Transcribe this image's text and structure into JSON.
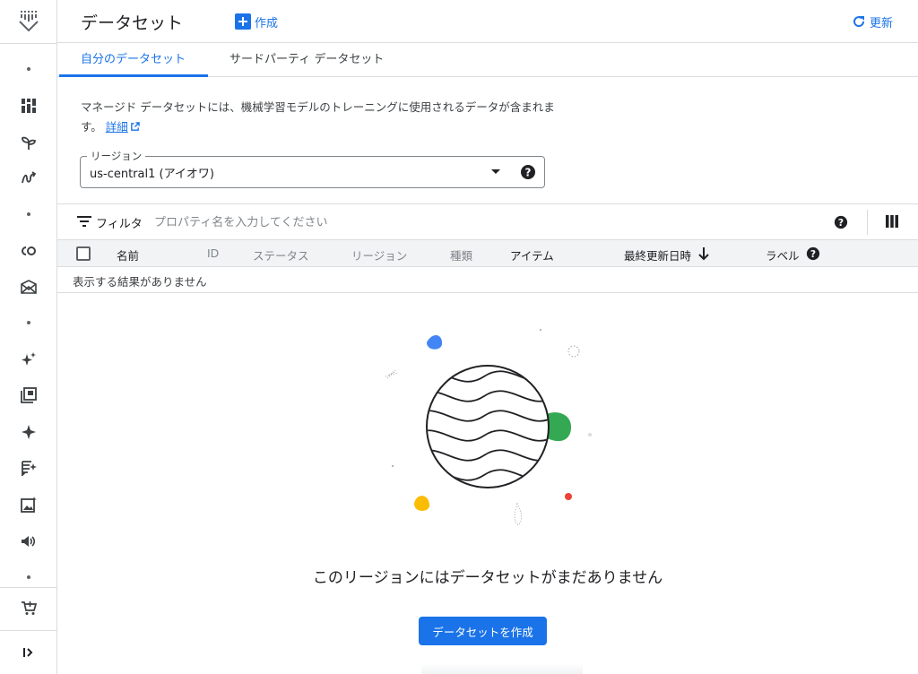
{
  "header": {
    "title": "データセット",
    "create_label": "作成",
    "refresh_label": "更新"
  },
  "tabs": [
    {
      "label": "自分のデータセット",
      "active": true
    },
    {
      "label": "サードパーティ データセット",
      "active": false
    }
  ],
  "description": {
    "text": "マネージド データセットには、機械学習モデルのトレーニングに使用されるデータが含まれます。",
    "link_label": "詳細"
  },
  "region": {
    "label": "リージョン",
    "value": "us-central1 (アイオワ)"
  },
  "filter": {
    "label": "フィルタ",
    "placeholder": "プロパティ名を入力してください"
  },
  "table": {
    "columns": [
      "名前",
      "ID",
      "ステータス",
      "リージョン",
      "種類",
      "アイテム",
      "最終更新日時",
      "ラベル"
    ],
    "empty_text": "表示する結果がありません"
  },
  "empty_state": {
    "message": "このリージョンにはデータセットがまだありません",
    "button_label": "データセットを作成"
  },
  "colors": {
    "accent": "#1a73e8",
    "blob_blue": "#4285f4",
    "blob_green": "#34a853",
    "blob_yellow": "#fbbc04",
    "blob_red": "#ea4335"
  },
  "rail_icons": [
    "vertex-ai-logo-icon",
    "dashboard-icon",
    "model-garden-icon",
    "pipelines-icon",
    "colab-icon",
    "workbench-icon",
    "generative-ai-icon",
    "prompt-gallery-icon",
    "sparkle-icon",
    "text-prompt-icon",
    "image-icon",
    "speech-icon",
    "marketplace-icon",
    "expand-icon"
  ]
}
